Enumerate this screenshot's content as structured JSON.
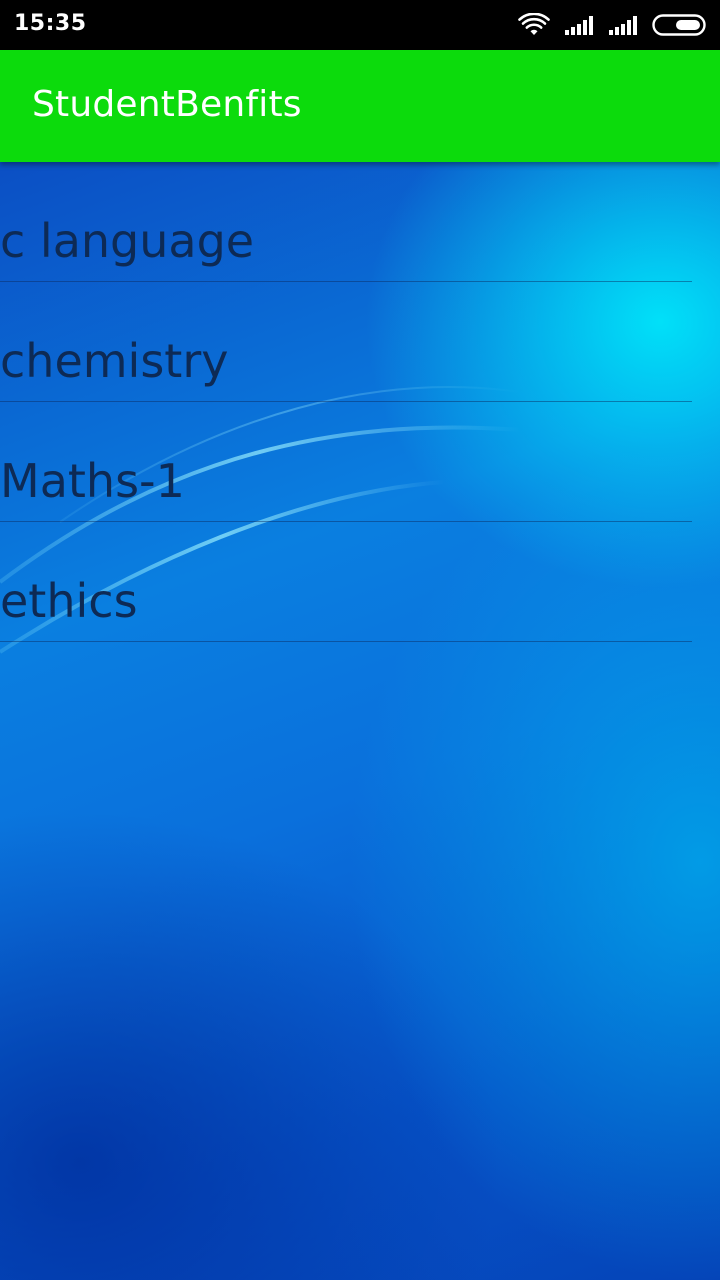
{
  "status_bar": {
    "time": "15:35",
    "icons": [
      "wifi-icon",
      "signal-icon",
      "signal-icon",
      "battery-icon"
    ]
  },
  "app_bar": {
    "title": "StudentBenfits",
    "color": "#0cdb0c"
  },
  "list": {
    "items": [
      {
        "label": "c language"
      },
      {
        "label": "chemistry"
      },
      {
        "label": "Maths-1"
      },
      {
        "label": "ethics"
      }
    ]
  },
  "colors": {
    "status_bar_bg": "#000000",
    "app_bar_bg": "#0cdb0c",
    "list_text": "#0d2a55"
  }
}
